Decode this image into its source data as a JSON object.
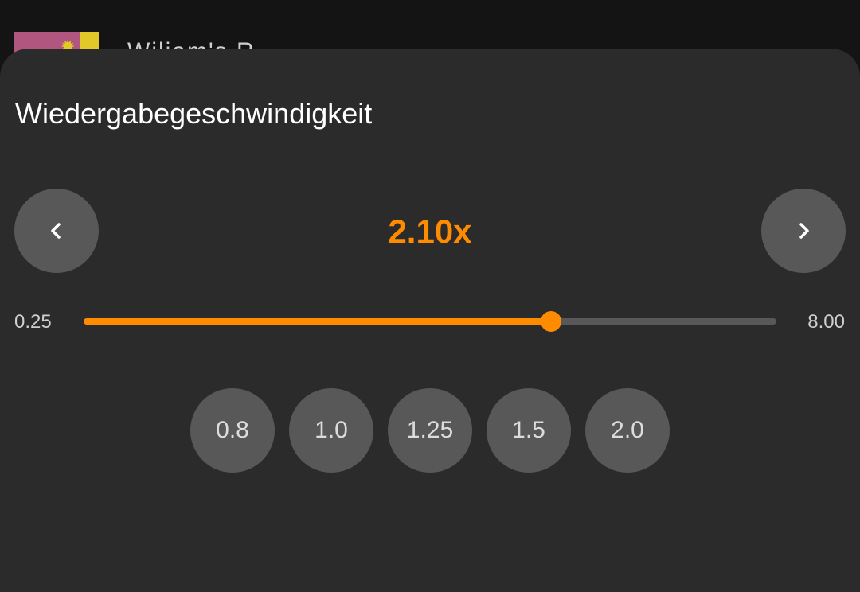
{
  "background": {
    "title_partial": "Wiliam's R..."
  },
  "sheet": {
    "title": "Wiedergabegeschwindigkeit",
    "speed_display": "2.10x",
    "speed_value": 2.1,
    "prev_icon": "chevron-left-icon",
    "next_icon": "chevron-right-icon",
    "slider": {
      "min_label": "0.25",
      "max_label": "8.00",
      "min": 0.25,
      "max": 8.0,
      "fill_fraction": 0.675
    },
    "presets": [
      "0.8",
      "1.0",
      "1.25",
      "1.5",
      "2.0"
    ]
  },
  "colors": {
    "accent": "#ff8c00",
    "sheet_background": "#2b2b2b",
    "button_background": "#585858"
  }
}
